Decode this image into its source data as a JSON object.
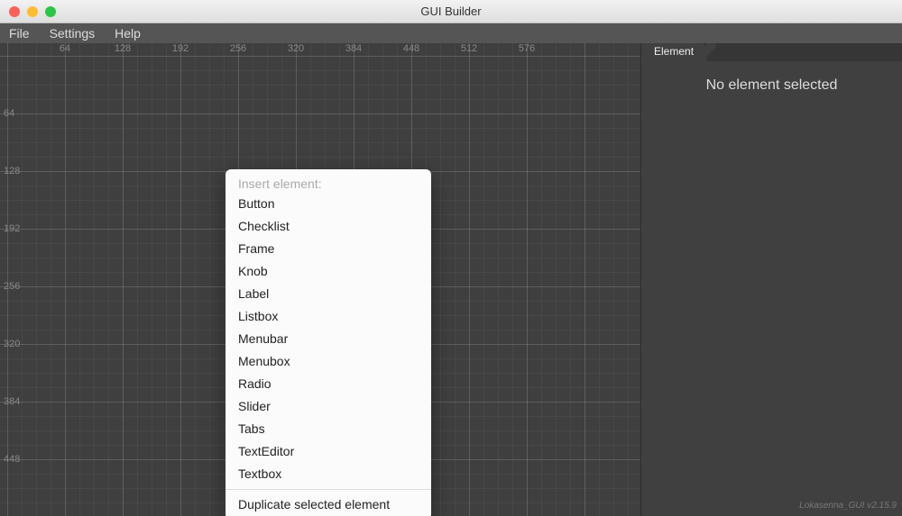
{
  "window": {
    "title": "GUI Builder"
  },
  "menubar": {
    "items": [
      {
        "label": "File"
      },
      {
        "label": "Settings"
      },
      {
        "label": "Help"
      }
    ]
  },
  "canvas": {
    "ruler_x": [
      "64",
      "128",
      "192",
      "256",
      "320",
      "384",
      "448",
      "512",
      "576"
    ],
    "ruler_y": [
      "64",
      "128",
      "192",
      "256",
      "320",
      "384",
      "448"
    ]
  },
  "context_menu": {
    "header": "Insert element:",
    "items": [
      "Button",
      "Checklist",
      "Frame",
      "Knob",
      "Label",
      "Listbox",
      "Menubar",
      "Menubox",
      "Radio",
      "Slider",
      "Tabs",
      "TextEditor",
      "Textbox"
    ],
    "duplicate_label": "Duplicate selected element"
  },
  "sidebar": {
    "tab_label": "Element",
    "empty_message": "No element selected"
  },
  "footer": {
    "version": "Lokasenna_GUI v2.15.9"
  }
}
